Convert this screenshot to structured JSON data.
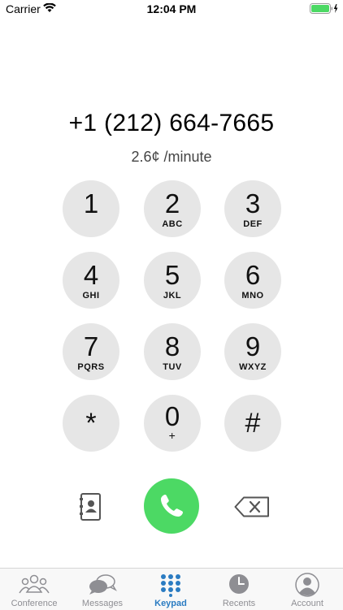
{
  "status_bar": {
    "carrier": "Carrier",
    "time": "12:04 PM"
  },
  "dialer": {
    "number": "+1 (212) 664-7665",
    "rate": "2.6¢ /minute"
  },
  "keypad": [
    {
      "digit": "1",
      "letters": ""
    },
    {
      "digit": "2",
      "letters": "ABC"
    },
    {
      "digit": "3",
      "letters": "DEF"
    },
    {
      "digit": "4",
      "letters": "GHI"
    },
    {
      "digit": "5",
      "letters": "JKL"
    },
    {
      "digit": "6",
      "letters": "MNO"
    },
    {
      "digit": "7",
      "letters": "PQRS"
    },
    {
      "digit": "8",
      "letters": "TUV"
    },
    {
      "digit": "9",
      "letters": "WXYZ"
    },
    {
      "digit": "*",
      "letters": ""
    },
    {
      "digit": "0",
      "letters": "+"
    },
    {
      "digit": "#",
      "letters": ""
    }
  ],
  "actions": {
    "contacts_icon": "contacts-book-icon",
    "call_icon": "phone-icon",
    "backspace_icon": "backspace-icon",
    "call_color": "#4cd964"
  },
  "tabs": [
    {
      "label": "Conference",
      "icon": "conference-icon"
    },
    {
      "label": "Messages",
      "icon": "messages-icon"
    },
    {
      "label": "Keypad",
      "icon": "keypad-icon",
      "active": true
    },
    {
      "label": "Recents",
      "icon": "clock-icon"
    },
    {
      "label": "Account",
      "icon": "person-icon"
    }
  ],
  "colors": {
    "accent": "#2b7cc2",
    "key_bg": "#e6e6e6",
    "battery": "#4cd964"
  }
}
